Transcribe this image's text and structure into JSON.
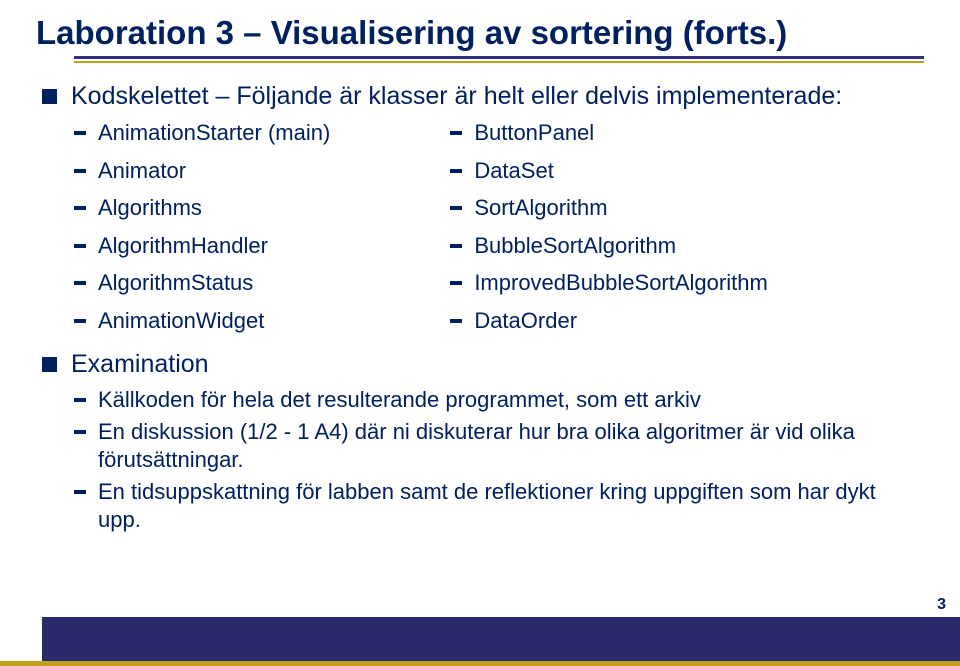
{
  "title": "Laboration 3 – Visualisering av sortering (forts.)",
  "section1": {
    "heading": "Kodskelettet – Följande är klasser är helt eller delvis implementerade:",
    "left": [
      "AnimationStarter (main)",
      "Animator",
      "Algorithms",
      "AlgorithmHandler",
      "AlgorithmStatus",
      "AnimationWidget"
    ],
    "right": [
      "ButtonPanel",
      "DataSet",
      "SortAlgorithm",
      "BubbleSortAlgorithm",
      "ImprovedBubbleSortAlgorithm",
      "DataOrder"
    ]
  },
  "section2": {
    "heading": "Examination",
    "items": [
      "Källkoden för hela det resulterande programmet, som ett arkiv",
      "En diskussion (1/2 - 1 A4) där ni diskuterar hur bra olika algoritmer är vid olika förutsättningar.",
      "En tidsuppskattning för labben samt de reflektioner kring uppgiften som har dykt upp."
    ]
  },
  "page_number": "3"
}
